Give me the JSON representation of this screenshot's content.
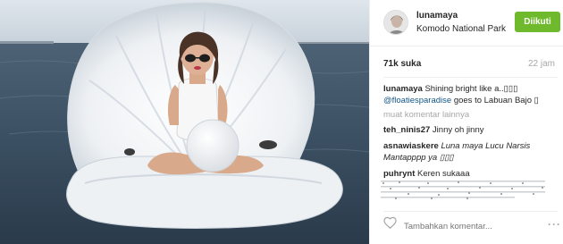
{
  "header": {
    "username": "lunamaya",
    "location": "Komodo National Park",
    "follow_label": "Diikuti"
  },
  "stats": {
    "likes": "71k suka",
    "time": "22 jam"
  },
  "caption": {
    "author": "lunamaya",
    "text_1": "Shining bright like a..▯▯▯",
    "mention": "@floatiesparadise",
    "text_2": "goes to Labuan Bajo ▯"
  },
  "more_comments": "muat komentar lainnya",
  "comments": [
    {
      "author": "teh_ninis27",
      "text": "Jinny oh jinny"
    },
    {
      "author": "asnawiaskere",
      "text": "Luna maya Lucu Narsis Mantapppp ya ▯▯▯"
    },
    {
      "author": "puhrynt",
      "text": "Keren sukaaa"
    }
  ],
  "footer": {
    "comment_placeholder": "Tambahkan komentar...",
    "more_icon": "more-options-icon",
    "like_icon": "heart-icon"
  },
  "colors": {
    "follow_bg": "#6fba2c",
    "mention": "#125688",
    "muted": "#a5a7aa"
  }
}
